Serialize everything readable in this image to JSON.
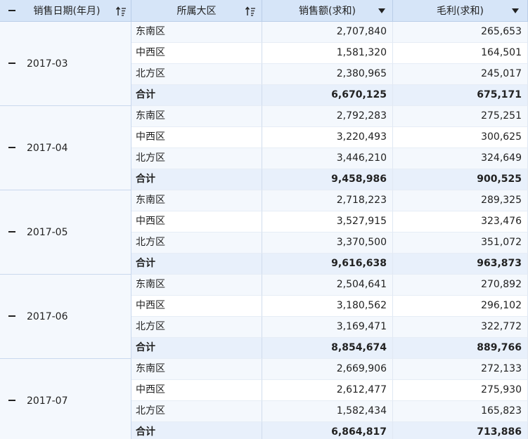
{
  "columns": {
    "sale_date": "销售日期(年月)",
    "region": "所属大区",
    "sales": "销售额(求和)",
    "profit": "毛利(求和)"
  },
  "icons": {
    "collapse": "minus-icon",
    "sort": "sort-ascending-icon",
    "dropdown": "dropdown-triangle-icon"
  },
  "groups": [
    {
      "label": "2017-03",
      "rows": [
        {
          "region": "东南区",
          "sales": "2,707,840",
          "profit": "265,653"
        },
        {
          "region": "中西区",
          "sales": "1,581,320",
          "profit": "164,501"
        },
        {
          "region": "北方区",
          "sales": "2,380,965",
          "profit": "245,017"
        },
        {
          "region": "合计",
          "sales": "6,670,125",
          "profit": "675,171",
          "subtotal": true
        }
      ]
    },
    {
      "label": "2017-04",
      "rows": [
        {
          "region": "东南区",
          "sales": "2,792,283",
          "profit": "275,251"
        },
        {
          "region": "中西区",
          "sales": "3,220,493",
          "profit": "300,625"
        },
        {
          "region": "北方区",
          "sales": "3,446,210",
          "profit": "324,649"
        },
        {
          "region": "合计",
          "sales": "9,458,986",
          "profit": "900,525",
          "subtotal": true
        }
      ]
    },
    {
      "label": "2017-05",
      "rows": [
        {
          "region": "东南区",
          "sales": "2,718,223",
          "profit": "289,325"
        },
        {
          "region": "中西区",
          "sales": "3,527,915",
          "profit": "323,476"
        },
        {
          "region": "北方区",
          "sales": "3,370,500",
          "profit": "351,072"
        },
        {
          "region": "合计",
          "sales": "9,616,638",
          "profit": "963,873",
          "subtotal": true
        }
      ]
    },
    {
      "label": "2017-06",
      "rows": [
        {
          "region": "东南区",
          "sales": "2,504,641",
          "profit": "270,892"
        },
        {
          "region": "中西区",
          "sales": "3,180,562",
          "profit": "296,102"
        },
        {
          "region": "北方区",
          "sales": "3,169,471",
          "profit": "322,772"
        },
        {
          "region": "合计",
          "sales": "8,854,674",
          "profit": "889,766",
          "subtotal": true
        }
      ]
    },
    {
      "label": "2017-07",
      "rows": [
        {
          "region": "东南区",
          "sales": "2,669,906",
          "profit": "272,133"
        },
        {
          "region": "中西区",
          "sales": "2,612,477",
          "profit": "275,930"
        },
        {
          "region": "北方区",
          "sales": "1,582,434",
          "profit": "165,823"
        },
        {
          "region": "合计",
          "sales": "6,864,817",
          "profit": "713,886",
          "subtotal": true
        }
      ]
    }
  ]
}
